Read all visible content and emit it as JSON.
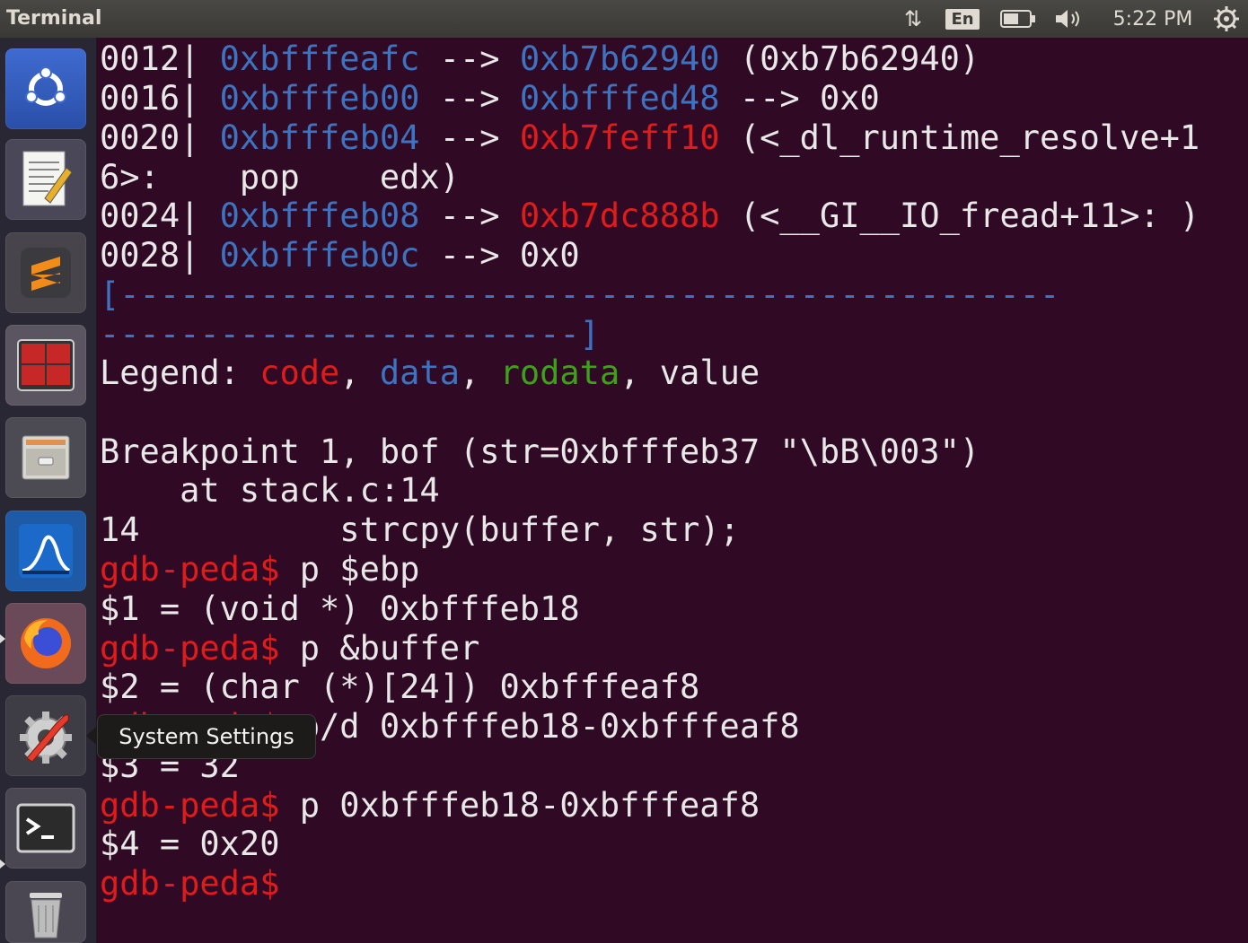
{
  "panel": {
    "title": "Terminal",
    "network_icon": "⇅",
    "keyboard_layout": "En",
    "sound_icon": "🔊",
    "clock": "5:22 PM",
    "power_icon": "⚙"
  },
  "launcher": {
    "items": [
      {
        "name": "ubuntu-dash",
        "label": "Search your computer"
      },
      {
        "name": "text-editor",
        "label": "Text Editor"
      },
      {
        "name": "sublime-text",
        "label": "Sublime Text"
      },
      {
        "name": "terminator",
        "label": "Terminator"
      },
      {
        "name": "files",
        "label": "Files"
      },
      {
        "name": "wireshark",
        "label": "Wireshark"
      },
      {
        "name": "firefox",
        "label": "Firefox"
      },
      {
        "name": "system-settings",
        "label": "System Settings"
      },
      {
        "name": "terminal",
        "label": "Terminal"
      },
      {
        "name": "trash",
        "label": "Trash"
      }
    ],
    "tooltip": "System Settings"
  },
  "terminal": {
    "stack": [
      {
        "offset": "0012| ",
        "addr": "0xbfffeafc",
        "arrow": " --> ",
        "value": "0xb7b62940",
        "rest": " (0xb7b62940)"
      },
      {
        "offset": "0016| ",
        "addr": "0xbfffeb00",
        "arrow": " --> ",
        "value": "0xbfffed48",
        "rest": " --> 0x0"
      },
      {
        "offset": "0020| ",
        "addr": "0xbfffeb04",
        "arrow": " --> ",
        "value": "0xb7feff10",
        "rest": " (<_dl_runtime_resolve+1"
      },
      {
        "offset": "0024| ",
        "addr": "0xbfffeb08",
        "arrow": " --> ",
        "value": "0xb7dc888b",
        "rest": " (<__GI__IO_fread+11>: )"
      },
      {
        "offset": "0028| ",
        "addr": "0xbfffeb0c",
        "arrow": " --> ",
        "value": "0x0",
        "rest": ""
      }
    ],
    "continuation": "6>:    pop    edx)",
    "separator_1": "[-----------------------------------------------",
    "separator_2": "------------------------]",
    "legend": {
      "prefix": "Legend: ",
      "code": "code",
      "data": "data",
      "rodata": "rodata",
      "value": "value"
    },
    "breakpoint_1": "Breakpoint 1, bof (str=0xbfffeb37 \"\\bB\\003\")",
    "breakpoint_2": "    at stack.c:14",
    "source_line": "14          strcpy(buffer, str);",
    "prompt": "gdb-peda$",
    "cmd_1": " p $ebp",
    "out_1": "$1 = (void *) 0xbfffeb18",
    "cmd_2": " p &buffer",
    "out_2": "$2 = (char (*)[24]) 0xbfffeaf8",
    "cmd_3": " p/d 0xbfffeb18-0xbfffeaf8",
    "out_3": "$3 = 32",
    "cmd_4": " p 0xbfffeb18-0xbfffeaf8",
    "out_4": "$4 = 0x20"
  }
}
